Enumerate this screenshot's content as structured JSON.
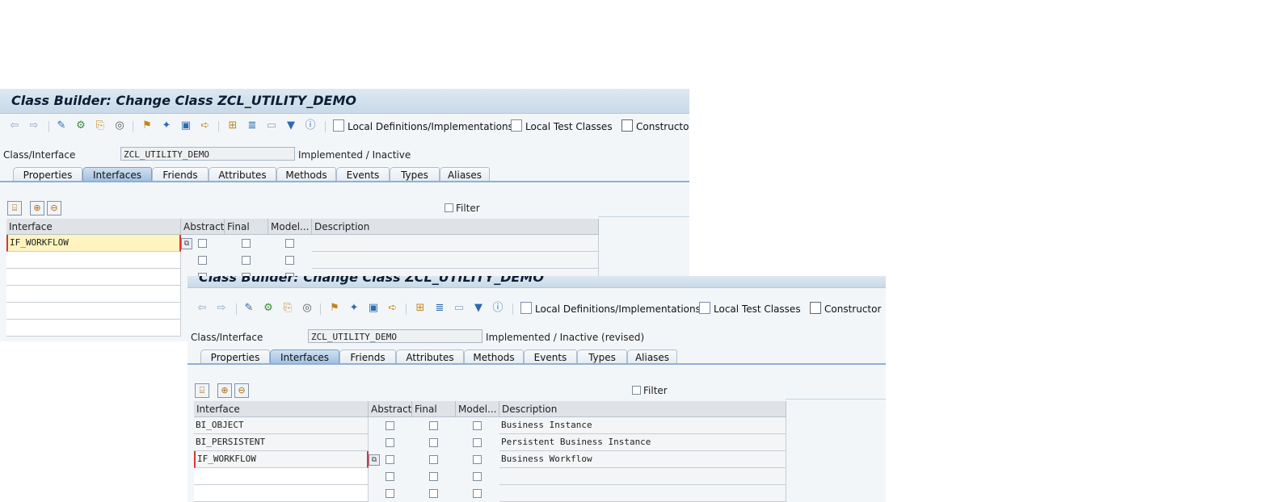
{
  "window1": {
    "title": "Class Builder: Change Class ZCL_UTILITY_DEMO",
    "toolbar": {
      "local_defs": "Local Definitions/Implementations",
      "local_test": "Local Test Classes",
      "constructor": "Constructor"
    },
    "class_label": "Class/Interface",
    "class_value": "ZCL_UTILITY_DEMO",
    "status": "Implemented / Inactive",
    "tabs": [
      "Properties",
      "Interfaces",
      "Friends",
      "Attributes",
      "Methods",
      "Events",
      "Types",
      "Aliases"
    ],
    "active_tab": "Interfaces",
    "filter_label": "Filter",
    "columns": [
      "Interface",
      "Abstract",
      "Final",
      "Model...",
      "Description"
    ],
    "rows": [
      {
        "interface": "IF_WORKFLOW",
        "description": ""
      },
      {
        "interface": "",
        "description": ""
      },
      {
        "interface": "",
        "description": ""
      }
    ]
  },
  "window2": {
    "toolbar": {
      "local_defs": "Local Definitions/Implementations",
      "local_test": "Local Test Classes",
      "constructor": "Constructor"
    },
    "class_label": "Class/Interface",
    "class_value": "ZCL_UTILITY_DEMO",
    "status": "Implemented / Inactive (revised)",
    "tabs": [
      "Properties",
      "Interfaces",
      "Friends",
      "Attributes",
      "Methods",
      "Events",
      "Types",
      "Aliases"
    ],
    "active_tab": "Interfaces",
    "filter_label": "Filter",
    "columns": [
      "Interface",
      "Abstract",
      "Final",
      "Model...",
      "Description"
    ],
    "rows": [
      {
        "interface": "BI_OBJECT",
        "description": "Business Instance"
      },
      {
        "interface": "BI_PERSISTENT",
        "description": "Persistent Business Instance"
      },
      {
        "interface": "IF_WORKFLOW",
        "description": "Business Workflow"
      },
      {
        "interface": "",
        "description": ""
      },
      {
        "interface": "",
        "description": ""
      }
    ]
  },
  "colors": {
    "title_bar": "#c9d9e8",
    "active_tab": "#9fbfe0",
    "edit_cell": "#fff4bf"
  }
}
